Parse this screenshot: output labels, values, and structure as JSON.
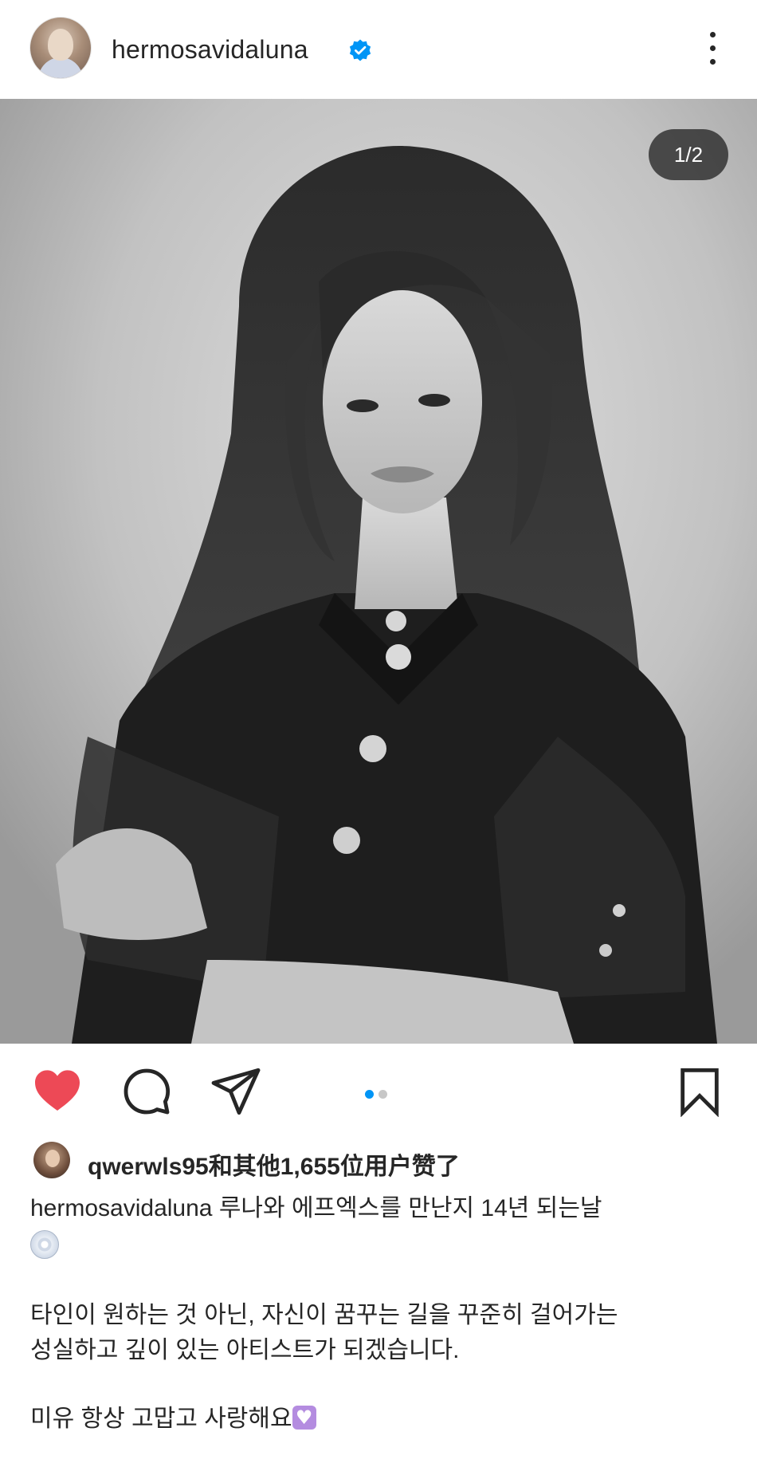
{
  "post": {
    "username": "hermosavidaluna",
    "verified_icon": "verified-badge-icon",
    "more_icon": "more-vertical-icon",
    "brand_blue": "#0095f6",
    "counter": "1/2"
  },
  "actions": {
    "like_icon": "heart-filled-icon",
    "like_color": "#ed4956",
    "comment_icon": "comment-icon",
    "share_icon": "send-icon",
    "save_icon": "bookmark-icon",
    "carousel_total": 2,
    "carousel_active": 1
  },
  "likes": {
    "text": "qwerwls95和其他1,655位用户赞了"
  },
  "caption": {
    "username": "hermosavidaluna",
    "line1": " 루나와 에프엑스를 만난지 14년 되는날",
    "line1_emoji": "cd-icon",
    "line2": "타인이 원하는 것 아닌, 자신이 꿈꾸는 길을 꾸준히 걸어가는",
    "line3": "성실하고 깊이 있는 아티스트가 되겠습니다.",
    "line4": "미유 항상 고맙고 사랑해요",
    "line4_emoji": "purple-heart-icon"
  }
}
